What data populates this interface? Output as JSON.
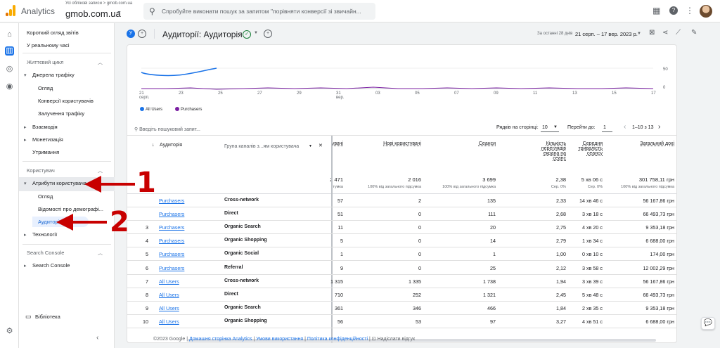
{
  "app": {
    "name": "Analytics",
    "account_path": "Усі облікові записи > gmob.com.ua",
    "account_name": "gmob.com.ua",
    "search_placeholder": "Спробуйте виконати пошук за запитом \"порівняти конверсії зі звичайн...",
    "icons": [
      "grid-icon",
      "help-icon",
      "more-vert-icon"
    ]
  },
  "sidebar": {
    "top_items": [
      "Короткий огляд звітів",
      "У реальному часі"
    ],
    "lifecycle": {
      "title": "Життєвий цикл",
      "traffic": "Джерела трафіку",
      "traffic_children": [
        "Огляд",
        "Конверсії користувачів",
        "Залучення трафіку"
      ],
      "others": [
        "Взаємодія",
        "Монетизація"
      ],
      "retention": "Утримання"
    },
    "user": {
      "title": "Користувач",
      "attrs": "Атрибути користувача",
      "attrs_children": [
        "Огляд",
        "Відомості про демографі...",
        "Аудиторії"
      ],
      "tech": "Технології"
    },
    "search_console": {
      "title": "Search Console",
      "item": "Search Console"
    },
    "library": "Бібліотека"
  },
  "header": {
    "badge": "У",
    "title": "Аудиторії: Аудиторія",
    "period_label": "За останні 28 днів",
    "dates": "21 серп. – 17 вер. 2023 р."
  },
  "chart_data": {
    "type": "line",
    "x": [
      "21 серп.",
      "23",
      "25",
      "27",
      "29",
      "31 вер.",
      "03",
      "05",
      "07",
      "09",
      "11",
      "13",
      "15",
      "17"
    ],
    "y_right_ticks": [
      "50",
      "0"
    ],
    "series": [
      {
        "name": "All Users",
        "color": "#1a73e8"
      },
      {
        "name": "Purchasers",
        "color": "#7b1fa2"
      }
    ]
  },
  "table": {
    "search_placeholder": "Введіть пошуковий запит...",
    "rows_per_page_label": "Рядків на сторінці:",
    "rows_per_page": "10",
    "goto_label": "Перейти до:",
    "goto_value": "1",
    "page_range": "1–10 з 13",
    "col_audience": "Аудиторія",
    "col_group": "Група каналів з...ям користувача",
    "metric_headers": [
      "увачі",
      "Нові користувачі",
      "Сеанси",
      "Кількість переглядів екрана на сеанс",
      "Середня тривалість сеансу",
      "Загальний дохі"
    ],
    "totals": [
      "2 471",
      "2 016",
      "3 699",
      "2,38",
      "5 хв 06 с",
      "301 758,11 грн"
    ],
    "totals_sub": [
      "тумка",
      "100% від загального підсумка",
      "100% від загального підсумка",
      "Сер. 0%",
      "Сер. 0%",
      "100% від загального підсумка"
    ],
    "rows": [
      {
        "n": "",
        "aud": "Purchasers",
        "grp": "Cross-network",
        "v": [
          "57",
          "2",
          "135",
          "2,33",
          "14 хв 46 с",
          "56 167,86 грн"
        ]
      },
      {
        "n": "",
        "aud": "Purchasers",
        "grp": "Direct",
        "v": [
          "51",
          "0",
          "111",
          "2,68",
          "3 хв 18 с",
          "66 493,73 грн"
        ]
      },
      {
        "n": "3",
        "aud": "Purchasers",
        "grp": "Organic Search",
        "v": [
          "11",
          "0",
          "20",
          "2,75",
          "4 хв 20 с",
          "9 353,18 грн"
        ]
      },
      {
        "n": "4",
        "aud": "Purchasers",
        "grp": "Organic Shopping",
        "v": [
          "5",
          "0",
          "14",
          "2,79",
          "1 хв 34 с",
          "6 688,00 грн"
        ]
      },
      {
        "n": "5",
        "aud": "Purchasers",
        "grp": "Organic Social",
        "v": [
          "1",
          "0",
          "1",
          "1,00",
          "0 хв 10 с",
          "174,00 грн"
        ]
      },
      {
        "n": "6",
        "aud": "Purchasers",
        "grp": "Referral",
        "v": [
          "9",
          "0",
          "25",
          "2,12",
          "3 хв 58 с",
          "12 002,29 грн"
        ]
      },
      {
        "n": "7",
        "aud": "All Users",
        "grp": "Cross-network",
        "v": [
          "1 315",
          "1 335",
          "1 738",
          "1,94",
          "3 хв 39 с",
          "56 167,86 грн"
        ]
      },
      {
        "n": "8",
        "aud": "All Users",
        "grp": "Direct",
        "v": [
          "710",
          "252",
          "1 321",
          "2,45",
          "5 хв 48 с",
          "66 493,73 грн"
        ]
      },
      {
        "n": "9",
        "aud": "All Users",
        "grp": "Organic Search",
        "v": [
          "361",
          "346",
          "466",
          "1,84",
          "2 хв 35 с",
          "9 353,18 грн"
        ]
      },
      {
        "n": "10",
        "aud": "All Users",
        "grp": "Organic Shopping",
        "v": [
          "56",
          "53",
          "97",
          "3,27",
          "4 хв 51 с",
          "6 688,00 грн"
        ]
      }
    ]
  },
  "footer": {
    "copyright": "©2023 Google |",
    "links": [
      "Домашня сторінка Analytics",
      "Умови використання",
      "Політика конфіденційності"
    ],
    "feedback": "Надіслати відгук"
  },
  "annotations": {
    "n1": "1",
    "n2": "2",
    "color": "#c80000"
  }
}
